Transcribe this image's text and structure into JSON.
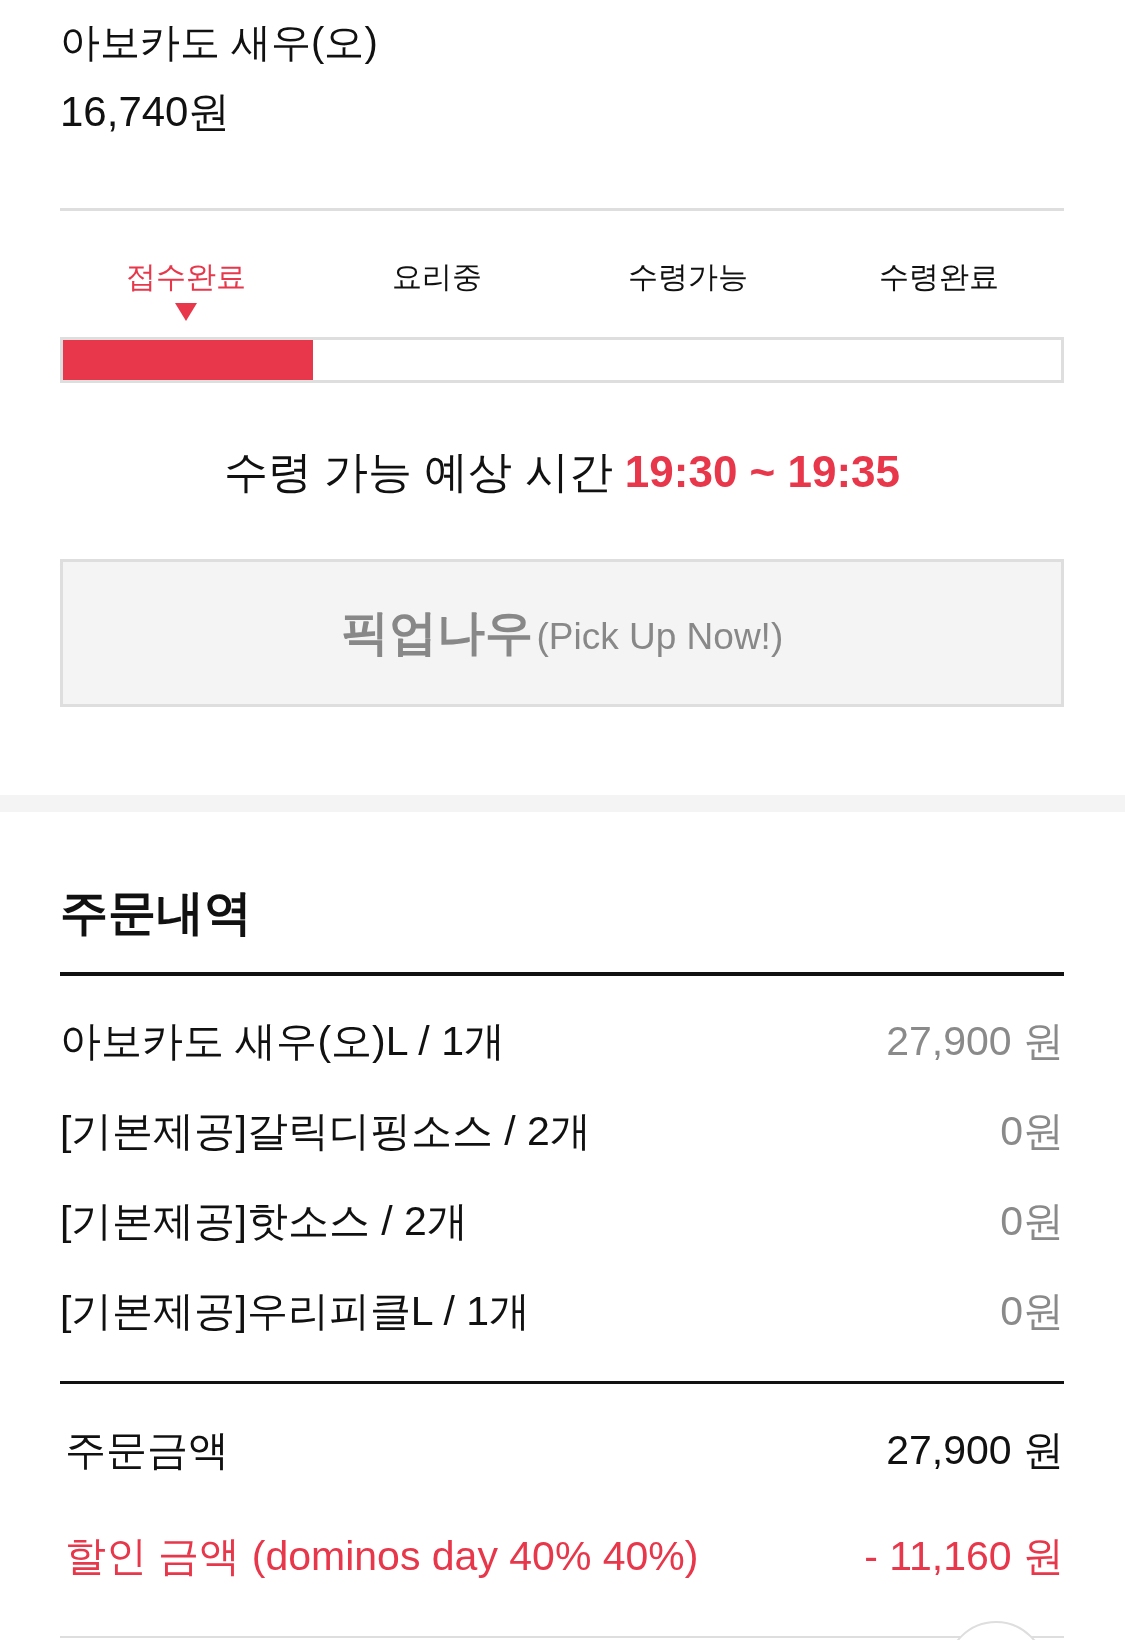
{
  "product": {
    "name": "아보카도 새우(오)",
    "price": "16,740원"
  },
  "progress": {
    "steps": [
      {
        "label": "접수완료",
        "selected": true
      },
      {
        "label": "요리중",
        "selected": false
      },
      {
        "label": "수령가능",
        "selected": false
      },
      {
        "label": "수령완료",
        "selected": false
      }
    ],
    "level": 0.25
  },
  "pickup_time": {
    "label": "수령 가능 예상 시간",
    "time": "19:30 ~ 19:35"
  },
  "pickup_button": {
    "label": "픽업나우",
    "sublabel": "(Pick Up Now!)",
    "disabled": true
  },
  "order": {
    "title": "주문내역",
    "items": [
      {
        "name": "아보카도 새우(오)L / 1개",
        "price": "27,900 원"
      },
      {
        "name": "[기본제공]갈릭디핑소스 / 2개",
        "price": "0원"
      },
      {
        "name": "[기본제공]핫소스 / 2개",
        "price": "0원"
      },
      {
        "name": "[기본제공]우리피클L / 1개",
        "price": "0원"
      }
    ],
    "summary": [
      {
        "kind": "total",
        "label": "주문금액",
        "value": "27,900 원"
      },
      {
        "kind": "discount",
        "label": "할인 금액 (dominos day 40% 40%)",
        "value": "- 11,160 원"
      }
    ]
  }
}
